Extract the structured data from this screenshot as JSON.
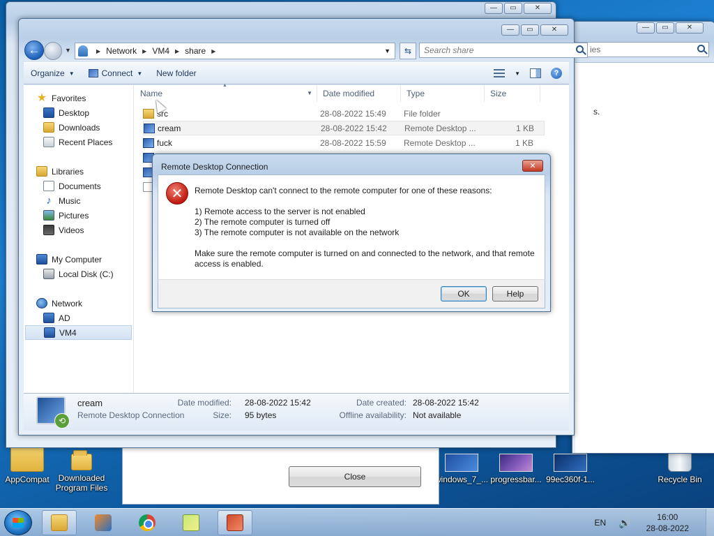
{
  "desktop": {
    "icons": [
      {
        "label": "AppCompat",
        "kind": "folder"
      },
      {
        "label": "Downloaded Program Files",
        "kind": "folder"
      },
      {
        "label": "windows_7_...",
        "kind": "thumb"
      },
      {
        "label": "progressbar...",
        "kind": "thumb"
      },
      {
        "label": "99ec360f-1...",
        "kind": "thumb"
      },
      {
        "label": "Recycle Bin",
        "kind": "recycle-bin"
      }
    ]
  },
  "back_window_2": {
    "search_partial": "ies",
    "text_partial": "s."
  },
  "close_dialog": {
    "close_button": "Close"
  },
  "explorer": {
    "address": {
      "segments": [
        "Network",
        "VM4",
        "share"
      ]
    },
    "search": {
      "placeholder": "Search share"
    },
    "toolbar": {
      "organize": "Organize",
      "connect": "Connect",
      "new_folder": "New folder"
    },
    "nav": {
      "favorites": {
        "label": "Favorites",
        "items": [
          "Desktop",
          "Downloads",
          "Recent Places"
        ]
      },
      "libraries": {
        "label": "Libraries",
        "items": [
          "Documents",
          "Music",
          "Pictures",
          "Videos"
        ]
      },
      "computer": {
        "label": "My Computer",
        "items": [
          "Local Disk (C:)"
        ]
      },
      "network": {
        "label": "Network",
        "items": [
          "AD",
          "VM4"
        ],
        "selected": "VM4"
      }
    },
    "columns": {
      "name": "Name",
      "date": "Date modified",
      "type": "Type",
      "size": "Size"
    },
    "files": [
      {
        "name": "src",
        "date": "28-08-2022 15:49",
        "type": "File folder",
        "size": "",
        "icon": "folder"
      },
      {
        "name": "cream",
        "date": "28-08-2022 15:42",
        "type": "Remote Desktop ...",
        "size": "1 KB",
        "icon": "rdp"
      },
      {
        "name": "fuck",
        "date": "28-08-2022 15:59",
        "type": "Remote Desktop ...",
        "size": "1 KB",
        "icon": "rdp"
      }
    ],
    "details": {
      "name": "cream",
      "type": "Remote Desktop Connection",
      "date_modified_label": "Date modified:",
      "date_modified": "28-08-2022 15:42",
      "size_label": "Size:",
      "size": "95 bytes",
      "date_created_label": "Date created:",
      "date_created": "28-08-2022 15:42",
      "offline_label": "Offline availability:",
      "offline": "Not available"
    }
  },
  "error_dialog": {
    "title": "Remote Desktop Connection",
    "line1": "Remote Desktop can't connect to the remote computer for one of these reasons:",
    "reasons": [
      "1) Remote access to the server is not enabled",
      "2) The remote computer is turned off",
      "3) The remote computer is not available on the network"
    ],
    "advice_1": "Make sure the remote computer is turned on and connected to the network, and that remote",
    "advice_2": "access is enabled.",
    "ok": "OK",
    "help": "Help"
  },
  "taskbar": {
    "apps": [
      "Windows Explorer",
      "Windows Media Player",
      "Google Chrome",
      "Sticky Notes",
      "Remote Desktop Connection"
    ],
    "language": "EN",
    "time": "16:00",
    "date": "28-08-2022"
  }
}
